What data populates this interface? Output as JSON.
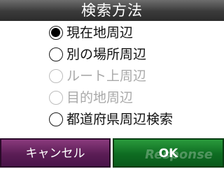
{
  "title": "検索方法",
  "options": [
    {
      "label": "現在地周辺",
      "selected": true,
      "enabled": true
    },
    {
      "label": "別の場所周辺",
      "selected": false,
      "enabled": true
    },
    {
      "label": "ルート上周辺",
      "selected": false,
      "enabled": false
    },
    {
      "label": "目的地周辺",
      "selected": false,
      "enabled": false
    },
    {
      "label": "都道府県周辺検索",
      "selected": false,
      "enabled": true
    }
  ],
  "buttons": {
    "cancel_label": "キャンセル",
    "ok_label": "OK"
  },
  "watermark": "Response",
  "colors": {
    "title_bg": "#3a3a3a",
    "cancel_bg": "#5b1d55",
    "ok_bg": "#0e6c22",
    "disabled_text": "#a9a9a9"
  }
}
